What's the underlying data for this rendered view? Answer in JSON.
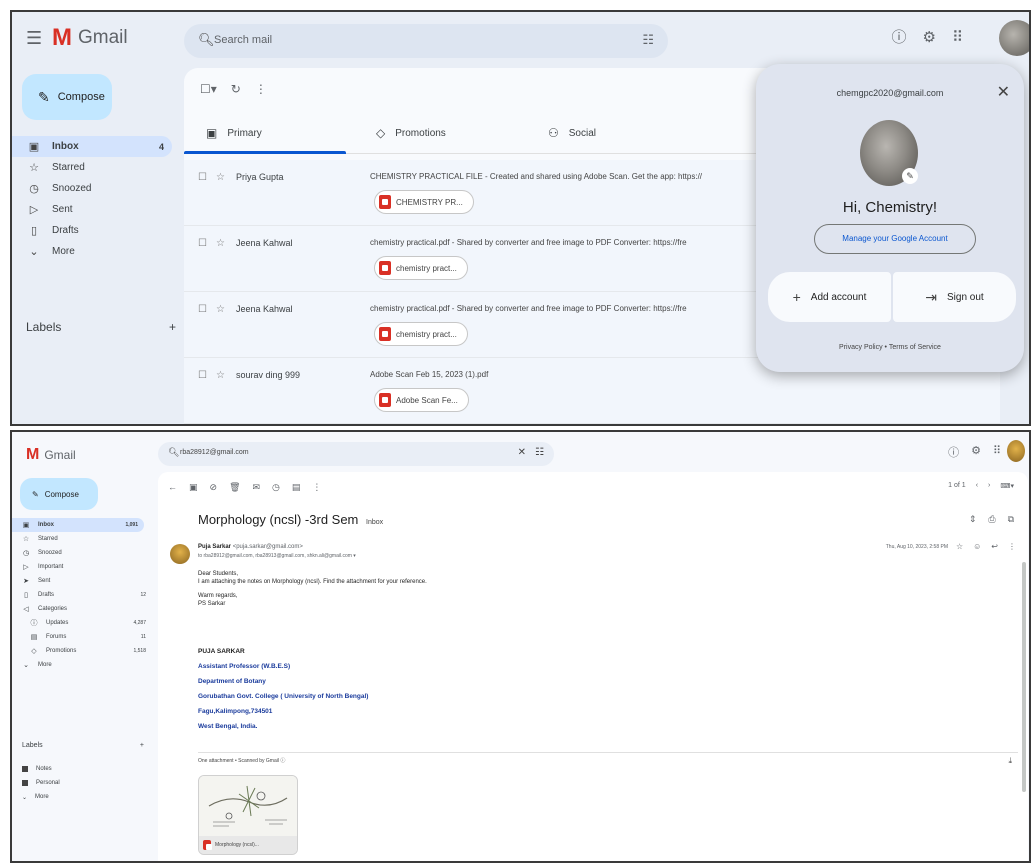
{
  "top": {
    "app_name": "Gmail",
    "search_placeholder": "Search mail",
    "compose_label": "Compose",
    "nav": [
      {
        "label": "Inbox",
        "count": "4",
        "icon": "inbox-icon"
      },
      {
        "label": "Starred",
        "count": "",
        "icon": "star-icon"
      },
      {
        "label": "Snoozed",
        "count": "",
        "icon": "clock-icon"
      },
      {
        "label": "Sent",
        "count": "",
        "icon": "send-icon"
      },
      {
        "label": "Drafts",
        "count": "",
        "icon": "draft-icon"
      },
      {
        "label": "More",
        "count": "",
        "icon": "chevron-down-icon"
      }
    ],
    "labels_heading": "Labels",
    "tabs": [
      {
        "label": "Primary",
        "icon": "inbox-icon"
      },
      {
        "label": "Promotions",
        "icon": "tag-icon"
      },
      {
        "label": "Social",
        "icon": "people-icon"
      }
    ],
    "emails": [
      {
        "sender": "Priya Gupta",
        "subject": "CHEMISTRY PRACTICAL FILE - Created and shared using Adobe Scan. Get the app: https://",
        "attachment": "CHEMISTRY PR..."
      },
      {
        "sender": "Jeena Kahwal",
        "subject": "chemistry practical.pdf - Shared by converter and free image to PDF Converter: https://fre",
        "attachment": "chemistry pract..."
      },
      {
        "sender": "Jeena Kahwal",
        "subject": "chemistry practical.pdf - Shared by converter and free image to PDF Converter: https://fre",
        "attachment": "chemistry pract..."
      },
      {
        "sender": "sourav ding 999",
        "subject": "Adobe Scan Feb 15, 2023 (1).pdf",
        "attachment": "Adobe Scan Fe..."
      }
    ],
    "account_popup": {
      "email": "chemgpc2020@gmail.com",
      "greeting": "Hi, Chemistry!",
      "manage_label": "Manage your Google Account",
      "add_account_label": "Add account",
      "sign_out_label": "Sign out",
      "footer": "Privacy Policy  •  Terms of Service"
    }
  },
  "bottom": {
    "app_name": "Gmail",
    "search_query": "rba28912@gmail.com",
    "compose_label": "Compose",
    "nav": [
      {
        "label": "Inbox",
        "count": "1,091",
        "sub": false,
        "icon": "inbox-icon"
      },
      {
        "label": "Starred",
        "count": "",
        "sub": false,
        "icon": "star-icon"
      },
      {
        "label": "Snoozed",
        "count": "",
        "sub": false,
        "icon": "clock-icon"
      },
      {
        "label": "Important",
        "count": "",
        "sub": false,
        "icon": "important-icon"
      },
      {
        "label": "Sent",
        "count": "",
        "sub": false,
        "icon": "send-icon"
      },
      {
        "label": "Drafts",
        "count": "12",
        "sub": false,
        "icon": "draft-icon"
      },
      {
        "label": "Categories",
        "count": "",
        "sub": false,
        "icon": "category-icon"
      },
      {
        "label": "Updates",
        "count": "4,287",
        "sub": true,
        "icon": "info-icon"
      },
      {
        "label": "Forums",
        "count": "11",
        "sub": true,
        "icon": "forum-icon"
      },
      {
        "label": "Promotions",
        "count": "1,518",
        "sub": true,
        "icon": "tag-icon"
      },
      {
        "label": "More",
        "count": "",
        "sub": false,
        "icon": "chevron-down-icon"
      }
    ],
    "labels_heading": "Labels",
    "labels": [
      "Notes",
      "Personal",
      "More"
    ],
    "subject": "Morphology (ncsl) -3rd Sem",
    "subject_tag": "Inbox",
    "sender_name": "Puja Sarkar",
    "sender_email": "<puja.sarkar@gmail.com>",
    "to_line": "to rba28912@gmail.com, rba28913@gmail.com, shkn.ali@gmail.com ▾",
    "date": "Thu, Aug 10, 2023, 2:58 PM",
    "pager": "1 of 1",
    "body_lines": [
      "Dear Students,",
      "I am attaching the notes on Morphology (ncsl). Find the attachment for your reference."
    ],
    "regards": [
      "Warm regards,",
      "PS Sarkar"
    ],
    "signature_name": "PUJA SARKAR",
    "signature_lines": [
      "Assistant Professor (W.B.E.S)",
      "Department of Botany",
      "Gorubathan Govt. College ( University of North Bengal)",
      "Fagu,Kalimpong,734501",
      "West Bengal, India."
    ],
    "attachment_header": "One attachment  •  Scanned by Gmail ⓘ",
    "attachment_name": "Morphology (ncsl)..."
  }
}
